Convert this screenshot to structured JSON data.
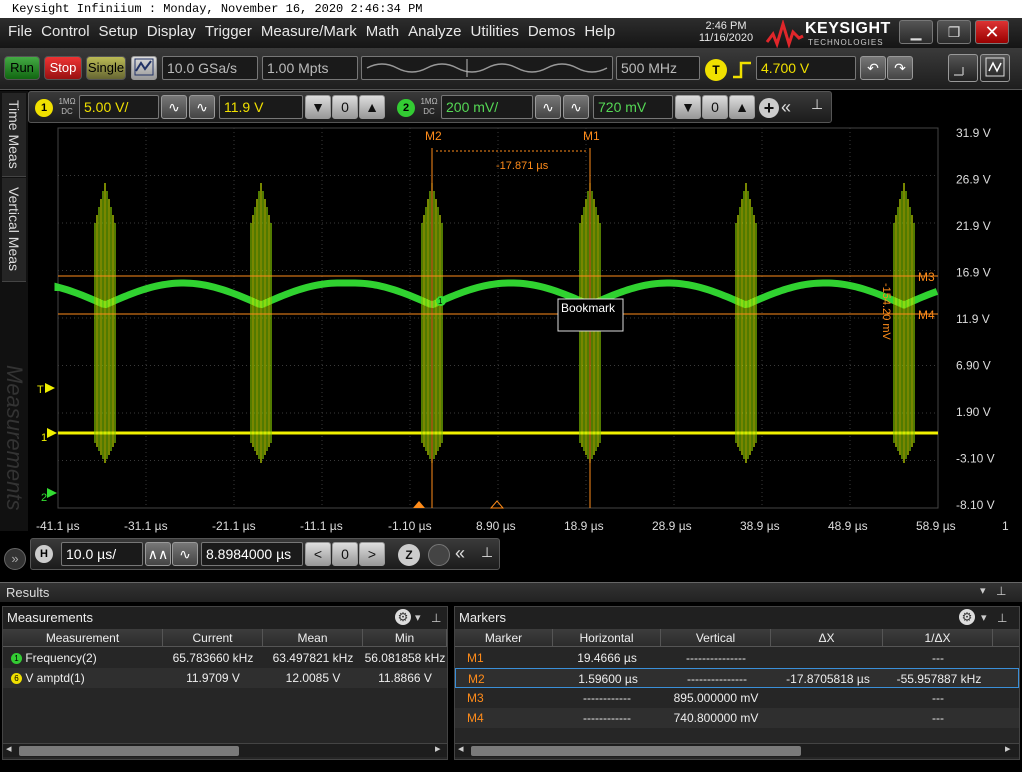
{
  "window": {
    "title": "Keysight Infiniium : Monday, November 16, 2020 2:46:34 PM"
  },
  "menu": [
    "File",
    "Control",
    "Setup",
    "Display",
    "Trigger",
    "Measure/Mark",
    "Math",
    "Analyze",
    "Utilities",
    "Demos",
    "Help"
  ],
  "clock": {
    "time": "2:46 PM",
    "date": "11/16/2020"
  },
  "logo": {
    "brand": "KEYSIGHT",
    "sub": "TECHNOLOGIES"
  },
  "toolbar": {
    "run": "Run",
    "stop": "Stop",
    "single": "Single",
    "sample_rate": "10.0 GSa/s",
    "memory_depth": "1.00 Mpts",
    "bandwidth": "500 MHz",
    "trigger_badge": "T",
    "trigger_level": "4.700 V"
  },
  "channels": {
    "ch1": {
      "num": "1",
      "coupling_top": "1MΩ",
      "coupling_bottom": "DC",
      "scale": "5.00 V/",
      "offset": "11.9 V"
    },
    "ch2": {
      "num": "2",
      "coupling_top": "1MΩ",
      "coupling_bottom": "DC",
      "scale": "200 mV/",
      "offset": "720 mV"
    }
  },
  "sidetabs": {
    "time_meas": "Time Meas",
    "vertical_meas": "Vertical Meas",
    "measurements": "Measurements"
  },
  "plot": {
    "y_labels": [
      "31.9 V",
      "26.9 V",
      "21.9 V",
      "16.9 V",
      "11.9 V",
      "6.90 V",
      "1.90 V",
      "-3.10 V",
      "-8.10 V"
    ],
    "x_labels": [
      "-41.1 µs",
      "-31.1 µs",
      "-21.1 µs",
      "-11.1 µs",
      "-1.10 µs",
      "8.90 µs",
      "18.9 µs",
      "28.9 µs",
      "38.9 µs",
      "48.9 µs",
      "58.9 µs"
    ],
    "x_label_extra": "1",
    "marker_m1": "M1",
    "marker_m2": "M2",
    "marker_m3": "M3",
    "marker_m4": "M4",
    "delta_t": "-17.871 µs",
    "delta_v": "-154.20 mV",
    "bookmark": "Bookmark",
    "trig_marker": "T",
    "ch1_marker": "1",
    "ch2_marker": "2",
    "ch1_waveform_badge": "1",
    "colors": {
      "ch1": "#f0f000",
      "ch2": "#33dd33",
      "marker": "#ff8c1a",
      "grid": "#3a3a3a"
    }
  },
  "horizontal": {
    "badge": "H",
    "scale": "10.0 µs/",
    "position": "8.8984000 µs"
  },
  "results": {
    "label": "Results"
  },
  "measurements": {
    "title": "Measurements",
    "columns": [
      "Measurement",
      "Current",
      "Mean",
      "Min"
    ],
    "rows": [
      {
        "badge": "1",
        "name": "Frequency(2)",
        "current": "65.783660 kHz",
        "mean": "63.497821 kHz",
        "min": "56.081858 kHz"
      },
      {
        "badge": "6",
        "name": "V amptd(1)",
        "current": "11.9709 V",
        "mean": "12.0085 V",
        "min": "11.8866 V"
      }
    ]
  },
  "markers": {
    "title": "Markers",
    "columns": [
      "Marker",
      "Horizontal",
      "Vertical",
      "ΔX",
      "1/ΔX"
    ],
    "rows": [
      {
        "marker": "M1",
        "horizontal": "19.4666 µs",
        "vertical": "---------------",
        "dx": "",
        "inv_dx": "---"
      },
      {
        "marker": "M2",
        "horizontal": "1.59600 µs",
        "vertical": "---------------",
        "dx": "-17.8705818 µs",
        "inv_dx": "-55.957887 kHz"
      },
      {
        "marker": "M3",
        "horizontal": "------------",
        "vertical": "895.000000 mV",
        "dx": "",
        "inv_dx": "---"
      },
      {
        "marker": "M4",
        "horizontal": "------------",
        "vertical": "740.800000 mV",
        "dx": "",
        "inv_dx": "---"
      }
    ]
  }
}
